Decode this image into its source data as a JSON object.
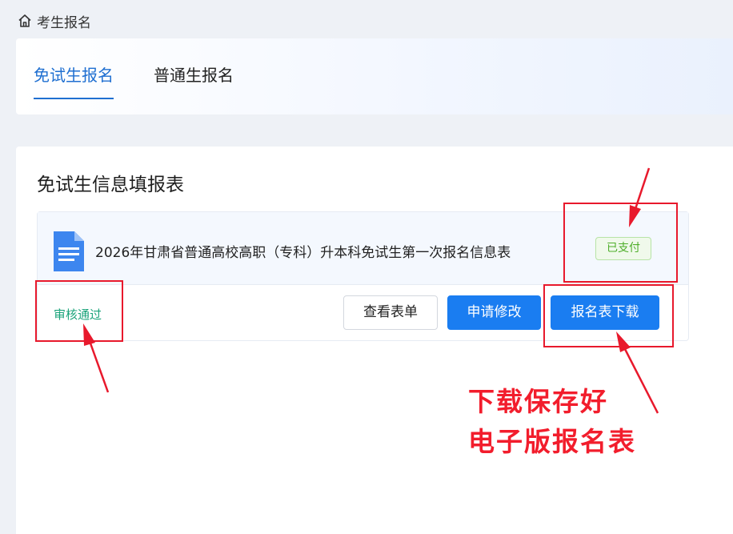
{
  "breadcrumb": {
    "icon": "home-icon",
    "label": "考生报名"
  },
  "tabs": [
    {
      "label": "免试生报名",
      "active": true
    },
    {
      "label": "普通生报名",
      "active": false
    }
  ],
  "form": {
    "title": "免试生信息填报表",
    "record": {
      "icon": "document-icon",
      "name": "2026年甘肃省普通高校高职（专科）升本科免试生第一次报名信息表",
      "payment_status": "已支付",
      "review_status": "审核通过",
      "buttons": {
        "view": "查看表单",
        "edit": "申请修改",
        "download": "报名表下载"
      }
    }
  },
  "annotation": {
    "line1": "下载保存好",
    "line2": "电子版报名表",
    "color": "#e8192c"
  },
  "colors": {
    "accent": "#1f6fd1",
    "primary_button": "#1a7df1",
    "paid_badge": "#4eae2a",
    "review_passed": "#1aa37a"
  }
}
